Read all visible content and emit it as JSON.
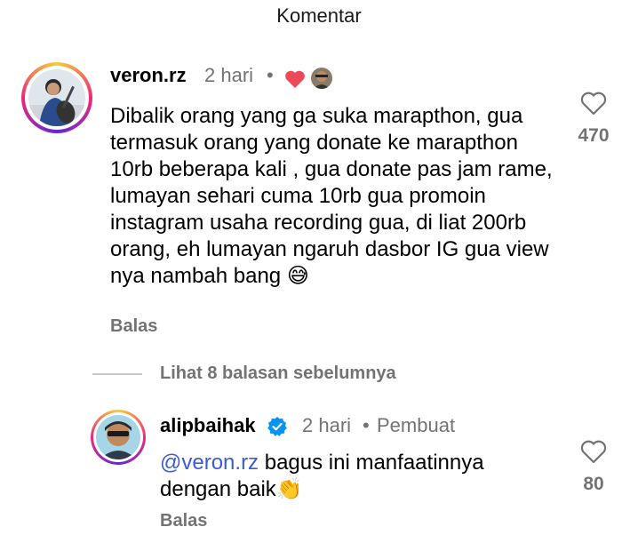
{
  "header": {
    "title": "Komentar"
  },
  "comment": {
    "username": "veron.rz",
    "time": "2 hari",
    "separator": "•",
    "text": "Dibalik orang yang ga suka marapthon, gua termasuk orang yang donate ke marapthon 10rb beberapa kali , gua donate pas jam rame, lumayan sehari cuma 10rb gua promoin instagram usaha recording gua, di liat 200rb orang, eh lumayan ngaruh dasbor IG gua view nya nambah bang 😅",
    "likes": "470",
    "reply_label": "Balas",
    "creator_liked_icon": "heart-icon"
  },
  "view_replies": {
    "label": "Lihat 8 balasan sebelumnya"
  },
  "reply": {
    "username": "alipbaihak",
    "verified_icon": "verified-badge-icon",
    "time": "2 hari",
    "separator": "•",
    "role": "Pembuat",
    "mention": "@veron.rz",
    "text": " bagus ini manfaatinnya dengan baik👏",
    "likes": "80",
    "reply_label": "Balas"
  },
  "colors": {
    "like_red": "#ed4956",
    "verified_blue": "#0095f6",
    "mention_blue": "#3b5bdb",
    "muted": "#737373"
  }
}
